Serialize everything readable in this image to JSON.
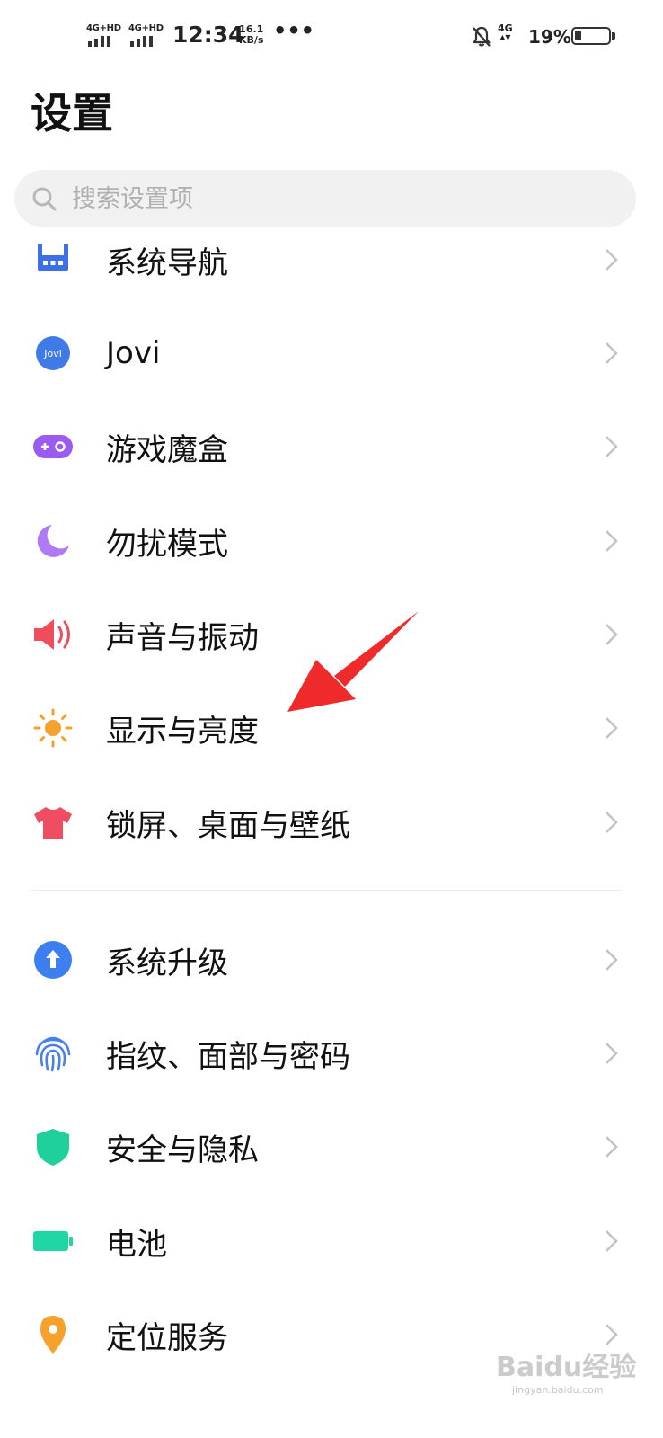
{
  "status_bar": {
    "sim1": "4G+HD",
    "sim2": "4G+HD",
    "time": "12:34",
    "speed_value": "16.1",
    "speed_unit": "KB/s",
    "more": "•••",
    "data_type": "4G",
    "battery": "19%"
  },
  "header": {
    "title": "设置"
  },
  "search": {
    "placeholder": "搜索设置项"
  },
  "items": [
    {
      "label": "系统导航",
      "icon": "navigation-icon",
      "color": "#3d6fe8"
    },
    {
      "label": "Jovi",
      "icon": "jovi-icon",
      "color": "#3f7ae6"
    },
    {
      "label": "游戏魔盒",
      "icon": "gamepad-icon",
      "color": "#9a5cf0"
    },
    {
      "label": "勿扰模式",
      "icon": "moon-icon",
      "color": "#b07af5"
    },
    {
      "label": "声音与振动",
      "icon": "speaker-icon",
      "color": "#ef4d5b"
    },
    {
      "label": "显示与亮度",
      "icon": "sun-icon",
      "color": "#f6a12c"
    },
    {
      "label": "锁屏、桌面与壁纸",
      "icon": "tshirt-icon",
      "color": "#ef4d62"
    },
    {
      "label": "系统升级",
      "icon": "upgrade-icon",
      "color": "#3d7ef0"
    },
    {
      "label": "指纹、面部与密码",
      "icon": "fingerprint-icon",
      "color": "#4a7ff0"
    },
    {
      "label": "安全与隐私",
      "icon": "shield-icon",
      "color": "#1fcf9c"
    },
    {
      "label": "电池",
      "icon": "battery-icon",
      "color": "#1fd6a5"
    },
    {
      "label": "定位服务",
      "icon": "location-pin-icon",
      "color": "#f6a12c"
    }
  ],
  "watermark": {
    "logo": "Baidu经验",
    "url": "jingyan.baidu.com"
  },
  "colors": {
    "annotation_arrow": "#ee2a2a",
    "chevron": "#c4c4c4"
  }
}
